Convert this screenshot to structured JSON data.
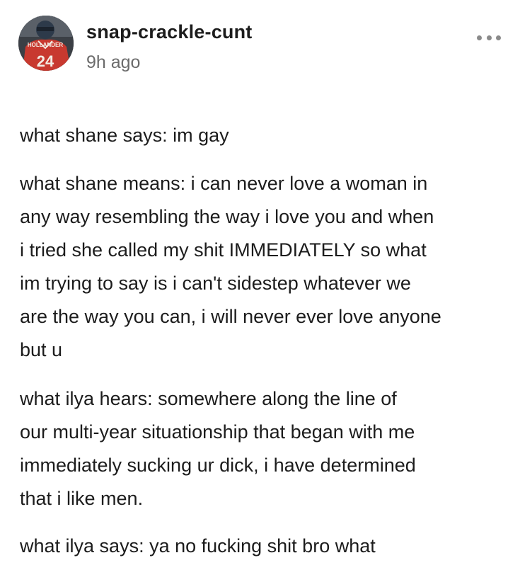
{
  "post": {
    "username": "snap-crackle-cunt",
    "timestamp": "9h ago",
    "avatar": {
      "icon": "hockey-player-avatar",
      "jersey_text": "HOLLANDER",
      "jersey_number": "24",
      "colors": {
        "jersey": "#c8392f",
        "helmet": "#2d3a4a",
        "background": "#3a3a3a"
      }
    },
    "menu_icon": "more-options-icon",
    "paragraphs": [
      {
        "lines": [
          "what shane says: im gay"
        ]
      },
      {
        "lines": [
          "what shane means: i can never love a woman in",
          "any way resembling the way i love you and when",
          "i tried she called my shit IMMEDIATELY so what",
          "im trying to say is i can't sidestep whatever we",
          "are the way you can, i will never ever love anyone",
          "but u"
        ]
      },
      {
        "lines": [
          "what ilya hears: somewhere along the line of",
          "our multi-year situationship that began with me",
          "immediately sucking ur dick, i have determined",
          "that i like men."
        ]
      },
      {
        "lines": [
          "what ilya says: ya no fucking shit bro what"
        ]
      }
    ]
  }
}
